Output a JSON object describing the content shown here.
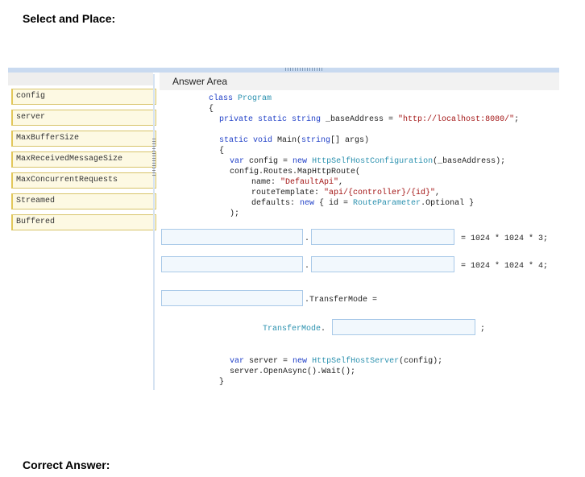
{
  "headings": {
    "top": "Select and Place:",
    "bottom": "Correct Answer:"
  },
  "options": [
    "config",
    "server",
    "MaxBufferSize",
    "MaxReceivedMessageSize",
    "MaxConcurrentRequests",
    "Streamed",
    "Buffered"
  ],
  "answer_area": {
    "title": "Answer Area",
    "code": {
      "l1": "class",
      "l1b": "Program",
      "l2": "{",
      "l3a": "private static string",
      "l3b": " _baseAddress = ",
      "l3c": "\"http://localhost:8080/\"",
      "l3d": ";",
      "l4a": "static void",
      "l4b": " Main(",
      "l4c": "string",
      "l4d": "[] args)",
      "l5": "{",
      "l6a": "var",
      "l6b": " config = ",
      "l6c": "new",
      "l6d": "HttpSelfHostConfiguration",
      "l6e": "(_baseAddress);",
      "l7": "config.Routes.MapHttpRoute(",
      "l8a": "name: ",
      "l8b": "\"DefaultApi\"",
      "l8c": ",",
      "l9a": "routeTemplate: ",
      "l9b": "\"api/{controller}/{id}\"",
      "l9c": ",",
      "l10a": "defaults: ",
      "l10b": "new",
      "l10c": " { id = ",
      "l10d": "RouteParameter",
      "l10e": ".Optional }",
      "l11": ");",
      "dot": ".",
      "assign3": "= 1024 * 1024 * 3;",
      "assign4": "= 1024 * 1024 * 4;",
      "transfer_mode": ".TransferMode =",
      "transfer_type": "TransferMode",
      "transfer_dot": ".",
      "semicolon": ";",
      "l12a": "var",
      "l12b": " server = ",
      "l12c": "new",
      "l12d": "HttpSelfHostServer",
      "l12e": "(config);",
      "l13": "server.OpenAsync().Wait();",
      "l14": "}"
    }
  },
  "colors": {
    "keyword": "#1f3fc7",
    "type": "#2b91af",
    "string": "#a31515",
    "option_bg": "#fdf9e3",
    "slot_bg": "#f2f8fd"
  }
}
